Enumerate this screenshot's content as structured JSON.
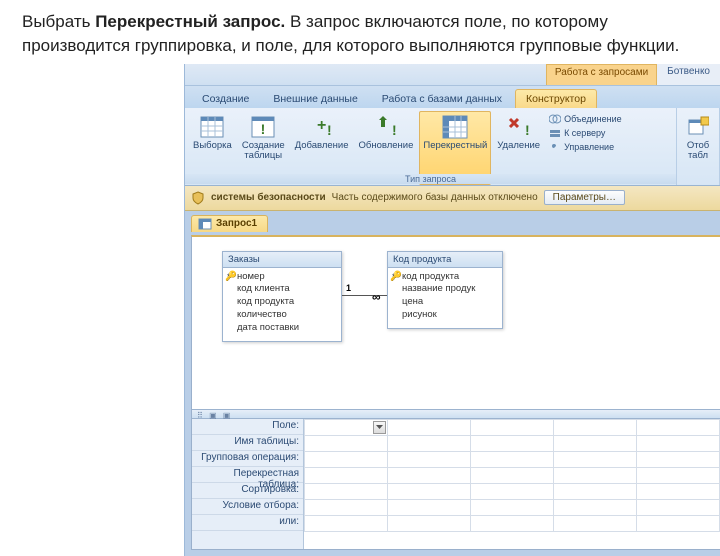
{
  "instruction": {
    "prefix": "Выбрать ",
    "bold": "Перекрестный запрос.",
    "rest": " В запрос включаются поле, по которому производится группировка, и поле, для которого выполняются групповые функции."
  },
  "contextTabs": {
    "work": "Работа с запросами",
    "extra": "Ботвенко"
  },
  "ribbonTabs": [
    "Создание",
    "Внешние данные",
    "Работа с базами данных",
    "Конструктор"
  ],
  "activeTab": 3,
  "queryTypes": {
    "select": "Выборка",
    "maketable": "Создание\nтаблицы",
    "append": "Добавление",
    "update": "Обновление",
    "crosstab": "Перекрестный",
    "delete": "Удаление",
    "union": "Объединение",
    "passthrough": "К серверу",
    "datadef": "Управление",
    "groupLabel": "Тип запроса"
  },
  "showGroup": {
    "show": "Отоб\nтабл"
  },
  "security": {
    "label": "системы безопасности",
    "msg": "Часть содержимого базы данных отключено",
    "button": "Параметры…"
  },
  "docTab": "Запрос1",
  "tables": {
    "orders": {
      "title": "Заказы",
      "fields": [
        "номер",
        "код клиента",
        "код продукта",
        "количество",
        "дата поставки"
      ]
    },
    "products": {
      "title": "Код продукта",
      "fields": [
        "код продукта",
        "название продук",
        "цена",
        "рисунок"
      ]
    }
  },
  "relation": {
    "one": "1",
    "many": "∞"
  },
  "gridRows": [
    "Поле:",
    "Имя таблицы:",
    "Групповая операция:",
    "Перекрестная таблица:",
    "Сортировка:",
    "Условие отбора:",
    "или:"
  ]
}
